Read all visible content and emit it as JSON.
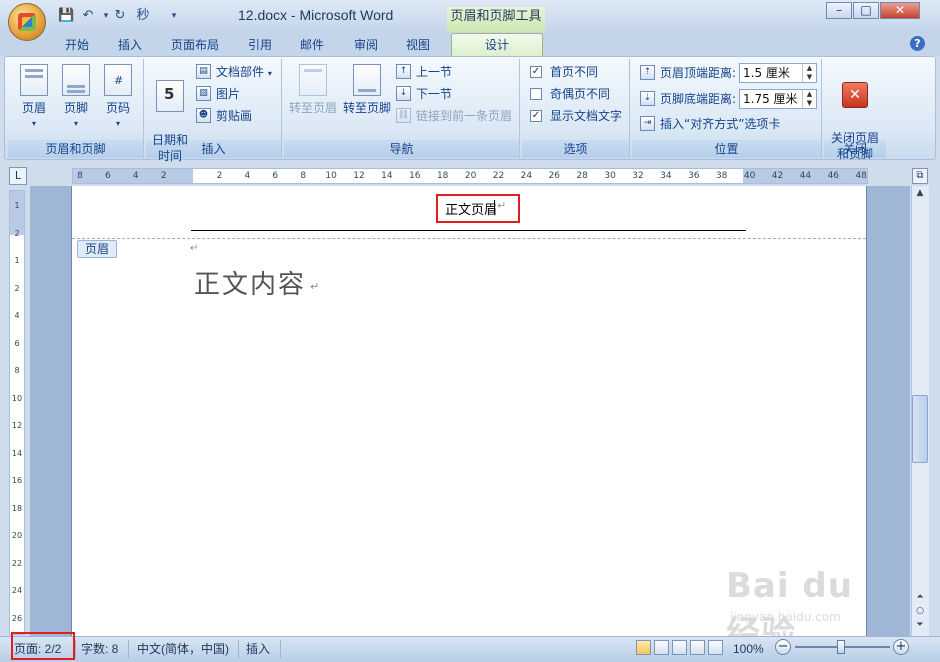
{
  "window": {
    "doc_title": "12.docx - Microsoft Word",
    "context_title": "页眉和页脚工具",
    "min": "–",
    "max": "□",
    "close": "✕",
    "qat_format_label": "秒"
  },
  "tabs": [
    "开始",
    "插入",
    "页面布局",
    "引用",
    "邮件",
    "审阅",
    "视图",
    "设计"
  ],
  "ribbon": {
    "groups": {
      "header_footer": {
        "label": "页眉和页脚",
        "header": "页眉",
        "footer": "页脚",
        "page_number": "页码"
      },
      "insert": {
        "label": "插入",
        "date_time": "日期和\n时间",
        "doc_parts": "文档部件",
        "picture": "图片",
        "clipart": "剪贴画"
      },
      "navigation": {
        "label": "导航",
        "goto_header": "转至页眉",
        "goto_footer": "转至页脚",
        "prev_section": "上一节",
        "next_section": "下一节",
        "link_prev": "链接到前一条页眉"
      },
      "options": {
        "label": "选项",
        "first_page_diff": "首页不同",
        "odd_even_diff": "奇偶页不同",
        "show_doc_text": "显示文档文字"
      },
      "position": {
        "label": "位置",
        "header_top_label": "页眉顶端距离:",
        "header_top_value": "1.5 厘米",
        "footer_bottom_label": "页脚底端距离:",
        "footer_bottom_value": "1.75 厘米",
        "insert_align_tab": "插入“对齐方式”选项卡"
      },
      "close": {
        "label": "关闭",
        "close_hf": "关闭页眉\n和页脚"
      }
    }
  },
  "ruler": {
    "h_ticks": [
      "8",
      "6",
      "4",
      "2",
      "",
      "2",
      "4",
      "6",
      "8",
      "10",
      "12",
      "14",
      "16",
      "18",
      "20",
      "22",
      "24",
      "26",
      "28",
      "30",
      "32",
      "34",
      "36",
      "38",
      "40",
      "42",
      "44",
      "46",
      "48"
    ],
    "v_ticks": [
      "1",
      "2",
      "1",
      "2",
      "4",
      "6",
      "8",
      "10",
      "12",
      "14",
      "16",
      "18",
      "20",
      "22",
      "24",
      "26"
    ]
  },
  "document": {
    "header_text": "正文页眉",
    "header_tag": "页眉",
    "body_text": "正文内容"
  },
  "statusbar": {
    "page": "页面: 2/2",
    "word_count": "字数: 8",
    "language": "中文(简体，中国)",
    "insert_mode": "插入",
    "zoom": "100%"
  },
  "watermark": {
    "big": "Bai du 经验",
    "small": "jingyan.baidu.com"
  },
  "colors": {
    "highlight_box": "#e02020",
    "design_tab": "#ddeecb"
  }
}
